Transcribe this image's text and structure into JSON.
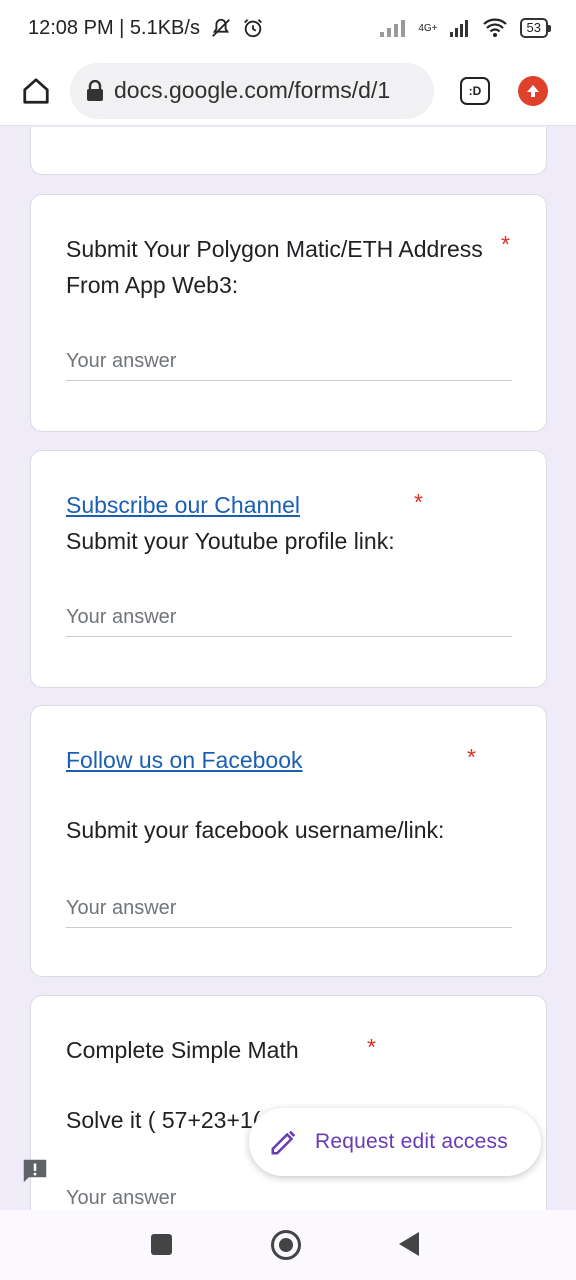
{
  "status_bar": {
    "time_speed": "12:08 PM | 5.1KB/s",
    "network": "4G+",
    "battery": "53"
  },
  "browser": {
    "url": "docs.google.com/forms/d/1",
    "tab_label": ":D"
  },
  "questions": [
    {
      "title_line1": "Submit Your Polygon Matic/ETH Address",
      "title_line2": "From App Web3:",
      "required_mark": "*",
      "placeholder": "Your answer"
    },
    {
      "link": "Subscribe our Channel",
      "title": "Submit your Youtube profile link:",
      "required_mark": "*",
      "placeholder": "Your answer"
    },
    {
      "link": "Follow us on Facebook",
      "title": "Submit your facebook username/link:",
      "required_mark": "*",
      "placeholder": "Your answer"
    },
    {
      "title": "Complete Simple Math",
      "subtitle": "Solve it ( 57+23+1(",
      "required_mark": "*",
      "placeholder": "Your answer"
    }
  ],
  "fab": {
    "label": "Request edit access"
  },
  "colors": {
    "accent": "#673ab7",
    "required": "#d93025",
    "link": "#1a5fb4",
    "background": "#f0ebf8"
  }
}
